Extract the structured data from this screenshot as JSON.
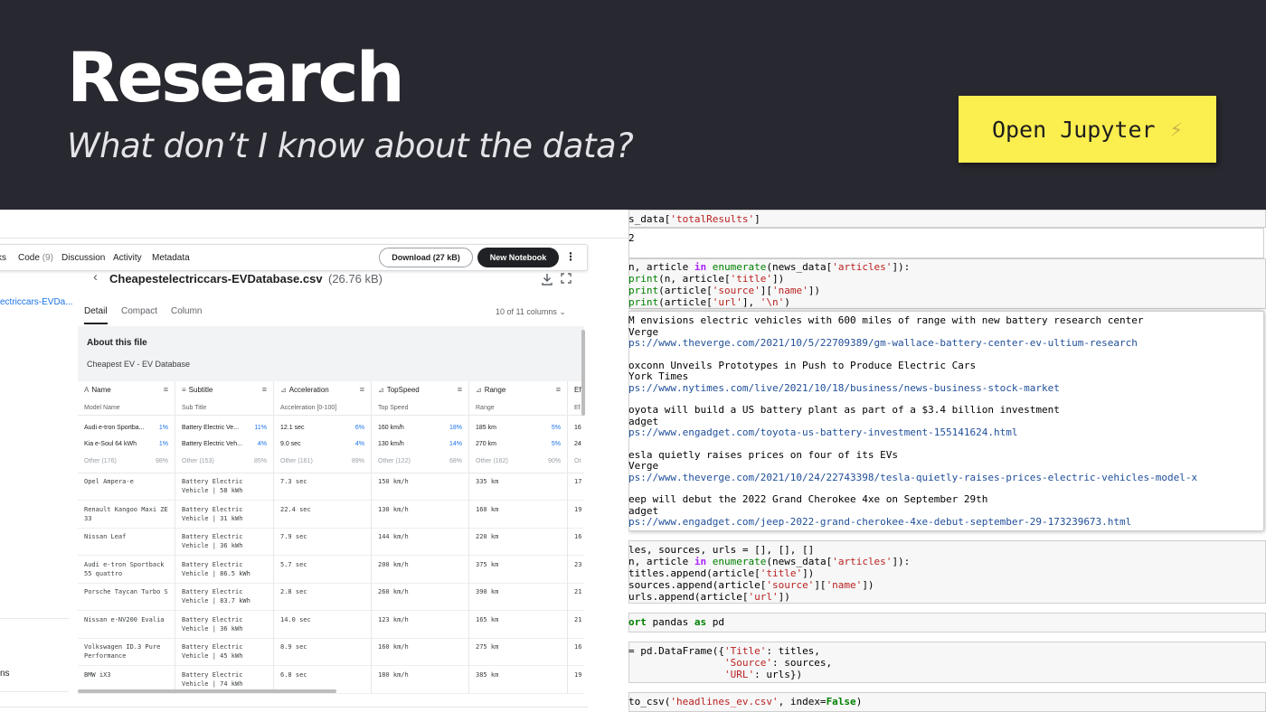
{
  "banner": {
    "title": "Research",
    "subtitle": "What don’t I know about the data?",
    "button_label": "Open Jupyter",
    "button_icon": "lightning-bolt-icon",
    "button_color": "#fbee4f",
    "background_color": "#282830"
  },
  "kaggle": {
    "tabs": [
      {
        "label": "ks",
        "count": ""
      },
      {
        "label": "Code",
        "count": "(9)"
      },
      {
        "label": "Discussion",
        "count": ""
      },
      {
        "label": "Activity",
        "count": ""
      },
      {
        "label": "Metadata",
        "count": ""
      }
    ],
    "download_label": "Download (27 kB)",
    "new_notebook_label": "New Notebook",
    "more_icon": "more-vertical-icon",
    "sidebar_link": "ectriccars-EVDa...",
    "sidebar_ns": "ns",
    "file_name": "Cheapestelectriccars-EVDatabase.csv",
    "file_size": "(26.76 kB)",
    "view_tabs": [
      "Detail",
      "Compact",
      "Column"
    ],
    "columns_info": "10 of 11 columns",
    "about_title": "About this file",
    "about_desc": "Cheapest EV - EV Database",
    "columns": [
      {
        "name": "Name",
        "desc": "Model Name"
      },
      {
        "name": "Subtitle",
        "desc": "Sub Title"
      },
      {
        "name": "Acceleration",
        "desc": "Acceleration [0-100]"
      },
      {
        "name": "TopSpeed",
        "desc": "Top Speed"
      },
      {
        "name": "Range",
        "desc": "Range"
      },
      {
        "name": "Ef",
        "desc": "Ef"
      }
    ],
    "stats": [
      [
        {
          "label": "Audi e-tron Sportba...",
          "pct": "1%"
        },
        {
          "label": "Kia e-Soul 64 kWh",
          "pct": "1%"
        },
        {
          "label": "Other (176)",
          "pct": "98%"
        }
      ],
      [
        {
          "label": "Battery Electric Ve...",
          "pct": "11%"
        },
        {
          "label": "Battery Electric Veh...",
          "pct": "4%"
        },
        {
          "label": "Other (153)",
          "pct": "85%"
        }
      ],
      [
        {
          "label": "12.1 sec",
          "pct": "6%"
        },
        {
          "label": "9.0 sec",
          "pct": "4%"
        },
        {
          "label": "Other (161)",
          "pct": "89%"
        }
      ],
      [
        {
          "label": "160 km/h",
          "pct": "18%"
        },
        {
          "label": "130 km/h",
          "pct": "14%"
        },
        {
          "label": "Other (122)",
          "pct": "68%"
        }
      ],
      [
        {
          "label": "185 km",
          "pct": "5%"
        },
        {
          "label": "270 km",
          "pct": "5%"
        },
        {
          "label": "Other (162)",
          "pct": "90%"
        }
      ],
      [
        {
          "label": "16",
          "pct": ""
        },
        {
          "label": "24",
          "pct": ""
        },
        {
          "label": "Ot",
          "pct": ""
        }
      ]
    ],
    "rows": [
      [
        "Opel Ampera-e",
        "Battery Electric Vehicle | 58 kWh",
        "7.3 sec",
        "150 km/h",
        "335 km",
        "17"
      ],
      [
        "Renault Kangoo Maxi ZE 33",
        "Battery Electric Vehicle | 31 kWh",
        "22.4 sec",
        "130 km/h",
        "160 km",
        "19"
      ],
      [
        "Nissan Leaf",
        "Battery Electric Vehicle | 36 kWh",
        "7.9 sec",
        "144 km/h",
        "220 km",
        "16"
      ],
      [
        "Audi e-tron Sportback 55 quattro",
        "Battery Electric Vehicle | 86.5 kWh",
        "5.7 sec",
        "200 km/h",
        "375 km",
        "23"
      ],
      [
        "Porsche Taycan Turbo S",
        "Battery Electric Vehicle | 83.7 kWh",
        "2.8 sec",
        "260 km/h",
        "390 km",
        "21"
      ],
      [
        "Nissan e-NV200 Evalia",
        "Battery Electric Vehicle | 36 kWh",
        "14.0 sec",
        "123 km/h",
        "165 km",
        "21"
      ],
      [
        "Volkswagen ID.3 Pure Performance",
        "Battery Electric Vehicle | 45 kWh",
        "8.9 sec",
        "160 km/h",
        "275 km",
        "16"
      ],
      [
        "BMW iX3",
        "Battery Electric Vehicle | 74 kWh",
        "6.8 sec",
        "180 km/h",
        "385 km",
        "19"
      ]
    ]
  },
  "jupyter": {
    "outputs": [
      {
        "title": "M envisions electric vehicles with 600 miles of range with new battery research center",
        "source": "Verge",
        "url": "ps://www.theverge.com/2021/10/5/22709389/gm-wallace-battery-center-ev-ultium-research"
      },
      {
        "title": "oxconn Unveils Prototypes in Push to Produce Electric Cars",
        "source": "York Times",
        "url": "ps://www.nytimes.com/live/2021/10/18/business/news-business-stock-market"
      },
      {
        "title": "oyota will build a US battery plant as part of a $3.4 billion investment",
        "source": "adget",
        "url": "ps://www.engadget.com/toyota-us-battery-investment-155141624.html"
      },
      {
        "title": "esla quietly raises prices on four of its EVs",
        "source": "Verge",
        "url": "ps://www.theverge.com/2021/10/24/22743398/tesla-quietly-raises-prices-electric-vehicles-model-x"
      },
      {
        "title": "eep will debut the 2022 Grand Cherokee 4xe on September 29th",
        "source": "adget",
        "url": "ps://www.engadget.com/jeep-2022-grand-cherokee-4xe-debut-september-29-173239673.html"
      }
    ]
  }
}
